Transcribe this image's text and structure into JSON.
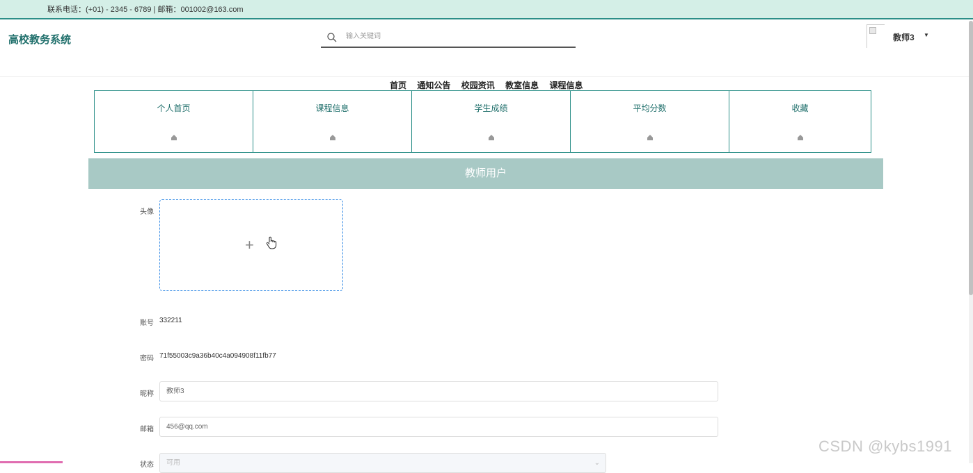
{
  "topbar": {
    "contact": "联系电话：(+01) - 2345 - 6789 | 邮箱：001002@163.com"
  },
  "header": {
    "logo": "高校教务系统",
    "search_placeholder": "输入关键词",
    "user_name": "教师3",
    "user_caret": "▼"
  },
  "nav": {
    "items": [
      "首页",
      "通知公告",
      "校园资讯",
      "教室信息",
      "课程信息"
    ]
  },
  "tabs": [
    {
      "label": "个人首页",
      "icon": "home-icon"
    },
    {
      "label": "课程信息",
      "icon": "home-icon"
    },
    {
      "label": "学生成绩",
      "icon": "home-icon"
    },
    {
      "label": "平均分数",
      "icon": "home-icon"
    },
    {
      "label": "收藏",
      "icon": "home-icon"
    }
  ],
  "banner": {
    "title": "教师用户"
  },
  "form": {
    "avatar_label": "头像",
    "upload_plus": "+",
    "account_label": "账号",
    "account_value": "332211",
    "password_label": "密码",
    "password_value": "71f55003c9a36b40c4a094908f11fb77",
    "nickname_label": "昵称",
    "nickname_value": "教师3",
    "email_label": "邮箱",
    "email_value": "456@qq.com",
    "status_label": "状态",
    "status_value": "可用",
    "status_arrow": "⌄"
  },
  "watermark": "CSDN @kybs1991",
  "colors": {
    "accent": "#2b8f88",
    "topbar_bg": "#d4efe7",
    "banner_bg": "#a8c9c5"
  }
}
